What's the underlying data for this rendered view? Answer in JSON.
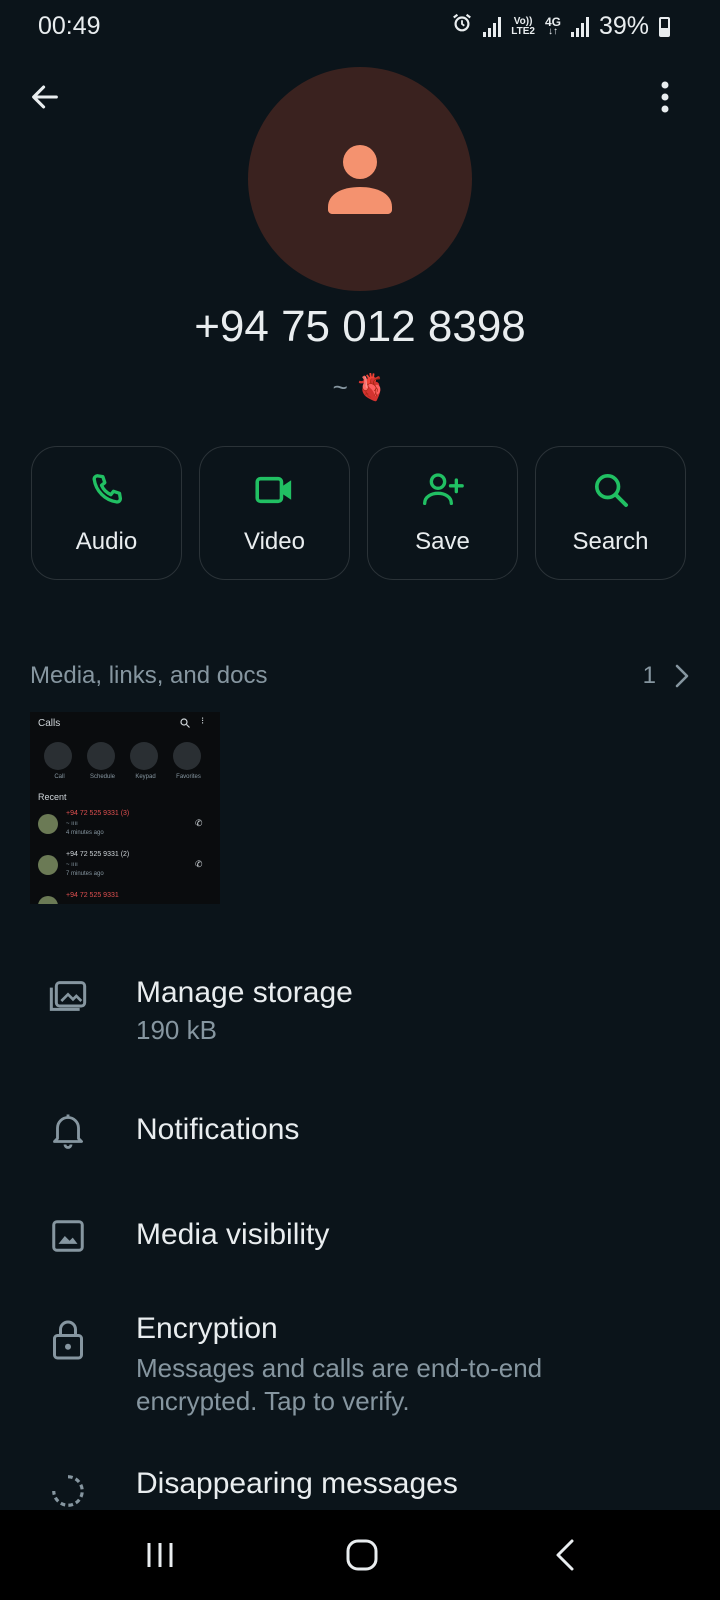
{
  "status_bar": {
    "time": "00:49",
    "network_label_top": "Vo))",
    "network_label_bottom": "LTE2",
    "network_type": "4G",
    "battery_percent": "39%",
    "icons": [
      "alarm-icon",
      "signal-icon",
      "volte-icon",
      "4g-icon",
      "signal-icon",
      "battery-icon"
    ]
  },
  "contact": {
    "phone": "+94 75 012 8398",
    "about": "~ 🫀"
  },
  "actions": [
    {
      "label": "Audio",
      "icon": "phone-icon"
    },
    {
      "label": "Video",
      "icon": "video-icon"
    },
    {
      "label": "Save",
      "icon": "add-person-icon"
    },
    {
      "label": "Search",
      "icon": "search-icon"
    }
  ],
  "media": {
    "title": "Media, links, and docs",
    "count": "1"
  },
  "thumbnail": {
    "header": "Calls",
    "shortcuts": [
      "Call",
      "Schedule",
      "Keypad",
      "Favorites"
    ],
    "recent_label": "Recent",
    "entries": [
      {
        "number": "+94 72 525 9331 (3)",
        "sub": "~ ıııı",
        "time": "4 minutes ago"
      },
      {
        "number": "+94 72 525 9331 (2)",
        "sub": "~ ıııı",
        "time": "7 minutes ago"
      },
      {
        "number": "+94 72 525 9331",
        "sub": "",
        "time": ""
      }
    ]
  },
  "settings": [
    {
      "title": "Manage storage",
      "subtitle": "190 kB",
      "icon": "storage-icon"
    },
    {
      "title": "Notifications",
      "subtitle": "",
      "icon": "bell-icon"
    },
    {
      "title": "Media visibility",
      "subtitle": "",
      "icon": "image-icon"
    },
    {
      "title": "Encryption",
      "subtitle": "Messages and calls are end-to-end encrypted. Tap to verify.",
      "icon": "lock-icon"
    },
    {
      "title": "Disappearing messages",
      "subtitle": "",
      "icon": "timer-icon"
    }
  ],
  "colors": {
    "background": "#0b141a",
    "accent": "#21c063",
    "avatar_bg": "#3a221f",
    "avatar_fg": "#f4926f",
    "missed_red": "#e05050"
  }
}
